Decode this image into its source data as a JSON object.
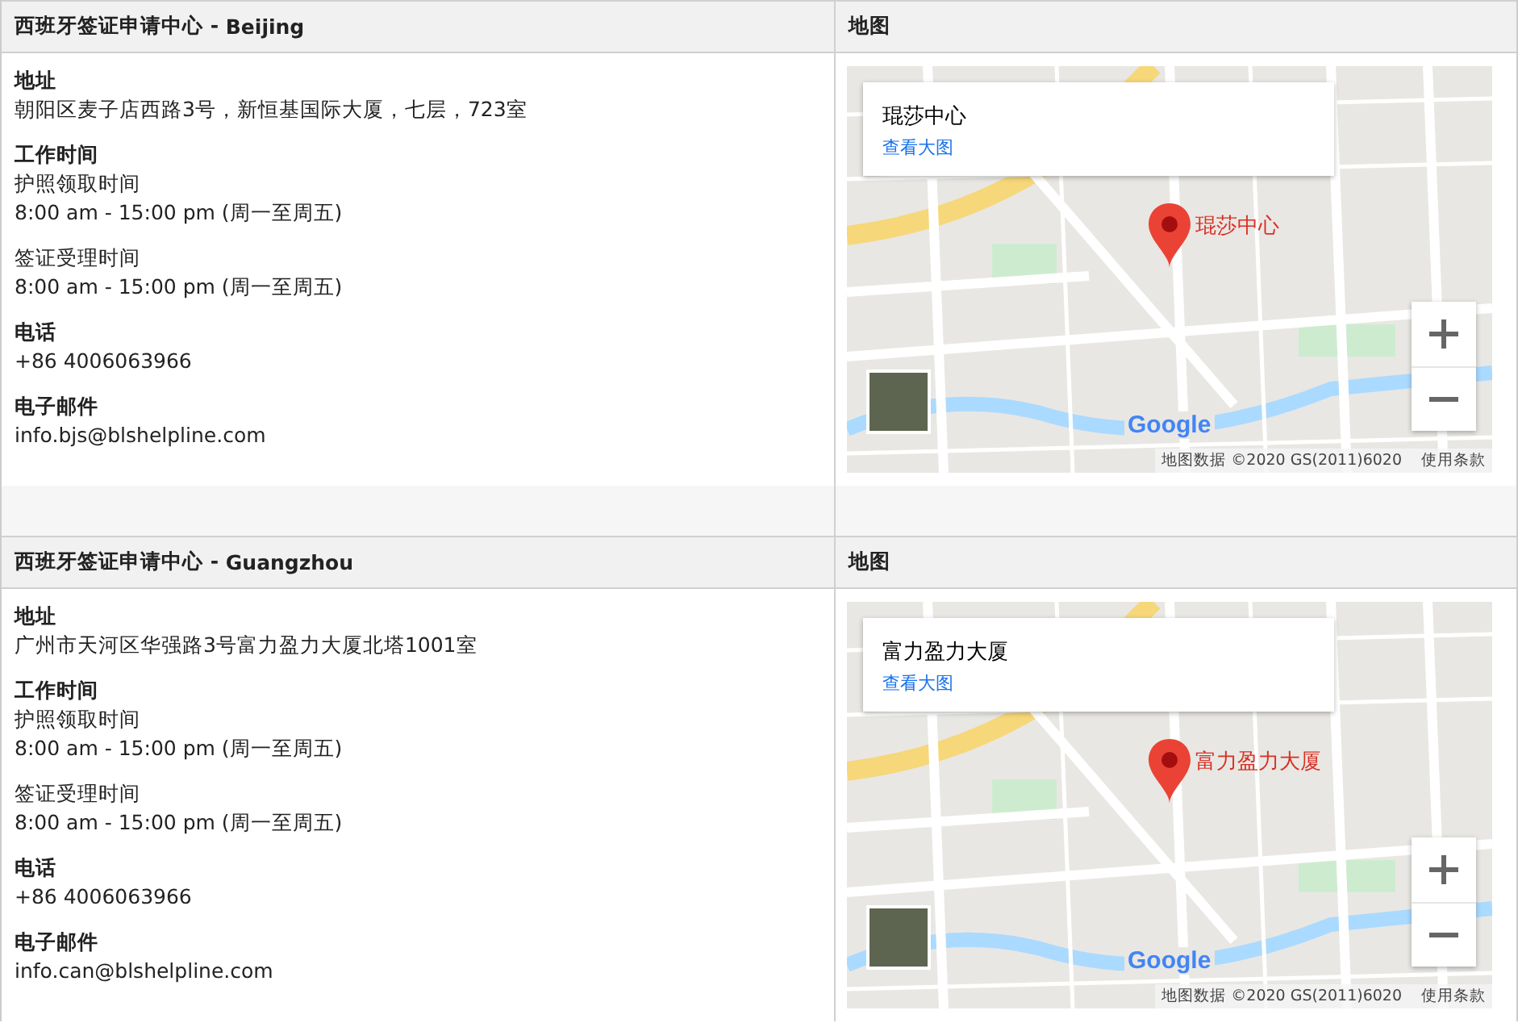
{
  "centers": [
    {
      "title_prefix": "西班牙签证申请中心 - ",
      "city": "Beijing",
      "map_heading": "地图",
      "sections": [
        {
          "label": "地址",
          "lines": [
            "朝阳区麦子店西路3号，新恒基国际大厦，七层，723室"
          ],
          "plain_label": false
        },
        {
          "label": "工作时间",
          "lines": [
            "护照领取时间",
            "8:00 am - 15:00 pm (周一至周五)"
          ],
          "plain_label": false
        },
        {
          "label": "签证受理时间",
          "lines": [
            "8:00 am - 15:00 pm (周一至周五)"
          ],
          "plain_label": true
        },
        {
          "label": "电话",
          "lines": [
            "+86 4006063966"
          ],
          "plain_label": false
        },
        {
          "label": "电子邮件",
          "lines": [
            "info.bjs@blshelpline.com"
          ],
          "plain_label": false
        }
      ],
      "map": {
        "place": "琨莎中心",
        "link": "查看大图",
        "marker_label": "琨莎中心",
        "logo": "Google",
        "attribution": "地图数据 ©2020 GS(2011)6020",
        "terms": "使用条款"
      }
    },
    {
      "title_prefix": "西班牙签证申请中心 - ",
      "city": "Guangzhou",
      "map_heading": "地图",
      "sections": [
        {
          "label": "地址",
          "lines": [
            "广州市天河区华强路3号富力盈力大厦北塔1001室"
          ],
          "plain_label": false
        },
        {
          "label": "工作时间",
          "lines": [
            "护照领取时间",
            "8:00 am - 15:00 pm (周一至周五)"
          ],
          "plain_label": false
        },
        {
          "label": "签证受理时间",
          "lines": [
            "8:00 am - 15:00 pm (周一至周五)"
          ],
          "plain_label": true
        },
        {
          "label": "电话",
          "lines": [
            "+86 4006063966"
          ],
          "plain_label": false
        },
        {
          "label": "电子邮件",
          "lines": [
            "info.can@blshelpline.com"
          ],
          "plain_label": false
        }
      ],
      "map": {
        "place": "富力盈力大厦",
        "link": "查看大图",
        "marker_label": "富力盈力大厦",
        "logo": "Google",
        "attribution": "地图数据 ©2020 GS(2011)6020",
        "terms": "使用条款"
      }
    }
  ]
}
